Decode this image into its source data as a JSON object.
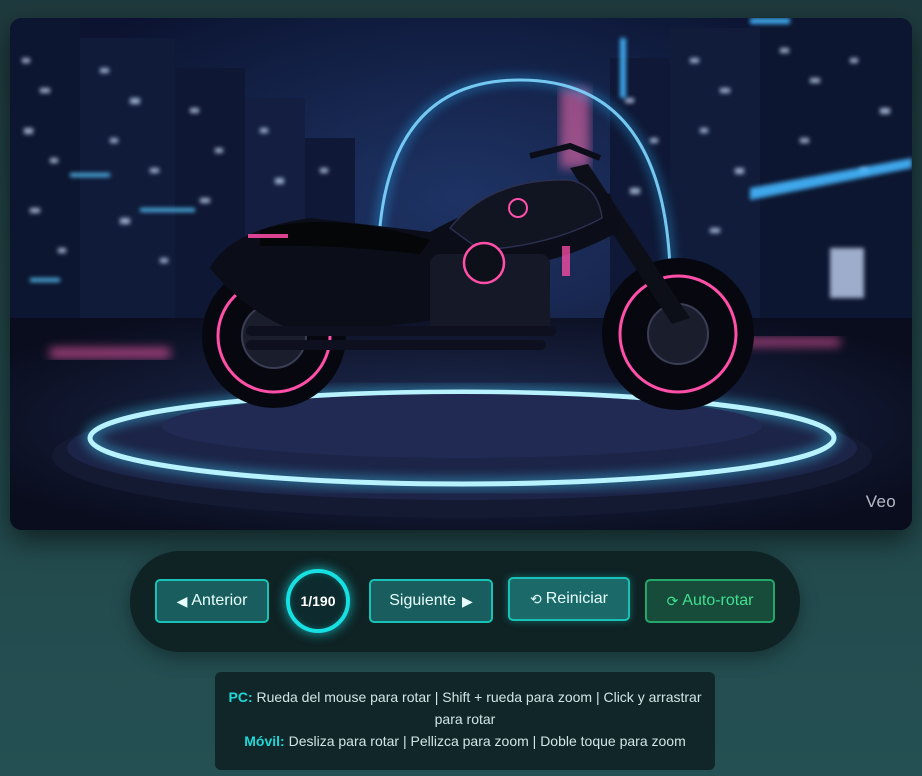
{
  "viewer": {
    "image_alt": "Motocicleta negra con luces neón sobre plataforma iluminada en ciudad nocturna",
    "watermark": "Veo",
    "current_frame": 1,
    "total_frames": 190
  },
  "controls": {
    "prev_icon": "◀",
    "prev_label": "Anterior",
    "counter": "1/190",
    "next_label": "Siguiente",
    "next_icon": "▶",
    "reset_icon": "⟲",
    "reset_label": "Reiniciar",
    "auto_icon": "⟳",
    "auto_label": "Auto-rotar"
  },
  "help": {
    "pc_label": "PC:",
    "pc_text": "Rueda del mouse para rotar | Shift + rueda para zoom | Click y arrastrar para rotar",
    "mobile_label": "Móvil:",
    "mobile_text": "Desliza para rotar | Pellizca para zoom | Doble toque para zoom"
  },
  "colors": {
    "accent_cyan": "#19c2b6",
    "counter_ring": "#17e0e3",
    "auto_green": "#23a86a",
    "neon_pink": "#ff4fa8",
    "neon_blue": "#2bb8ff"
  }
}
